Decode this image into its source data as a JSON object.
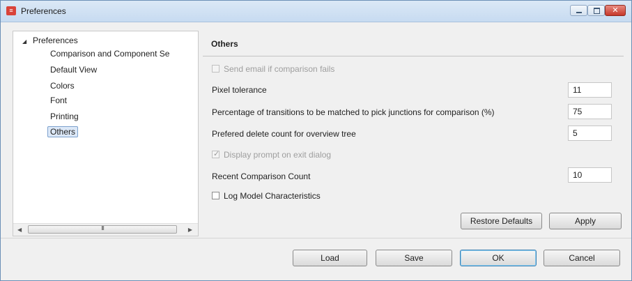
{
  "window": {
    "title": "Preferences",
    "icon": "app-icon"
  },
  "tree": {
    "root_label": "Preferences",
    "items": [
      {
        "label": "Comparison and Component Se"
      },
      {
        "label": "Default View"
      },
      {
        "label": "Colors"
      },
      {
        "label": "Font"
      },
      {
        "label": "Printing"
      },
      {
        "label": "Others",
        "selected": true
      }
    ],
    "scroll_grip": "III"
  },
  "page": {
    "title": "Others",
    "send_email": {
      "label": "Send email if comparison fails",
      "checked": false,
      "enabled": false
    },
    "pixel_tolerance": {
      "label": "Pixel tolerance",
      "value": "11"
    },
    "transitions": {
      "label": "Percentage of transitions to be matched to pick junctions for comparison (%)",
      "value": "75"
    },
    "delete_count": {
      "label": "Prefered delete count for overview tree",
      "value": "5"
    },
    "display_prompt": {
      "label": "Display prompt on exit dialog",
      "checked": true,
      "enabled": false
    },
    "recent_count": {
      "label": "Recent Comparison Count",
      "value": "10"
    },
    "log_model": {
      "label": "Log Model Characteristics",
      "checked": false,
      "enabled": true
    },
    "restore_label": "Restore Defaults",
    "apply_label": "Apply"
  },
  "footer": {
    "load_label": "Load",
    "save_label": "Save",
    "ok_label": "OK",
    "cancel_label": "Cancel"
  },
  "colors": {
    "accent": "#3c7fb1",
    "titlebar": "#c7dbf1",
    "close": "#c6382b"
  }
}
